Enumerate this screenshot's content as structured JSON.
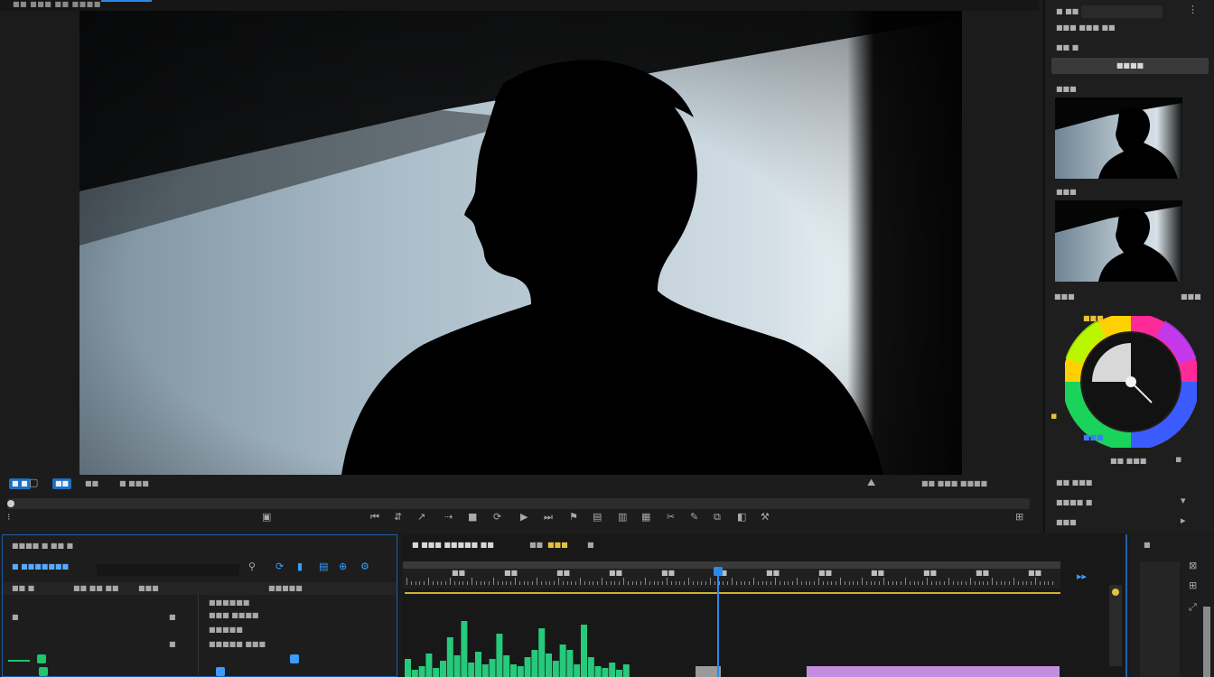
{
  "app": {
    "menu_text": "■■ ■■■ ■■ ■■■■",
    "accent": "#2b8ae8"
  },
  "viewer": {
    "control_tags": [
      "■ ■",
      "■■"
    ],
    "control_text_a": "■■",
    "control_text_b": "■ ■■■",
    "control_text_right": "■■ ■■■ ■■■■"
  },
  "inspector": {
    "header": "■ ■■ ■",
    "subheader": "■■■ ■■■ ■■",
    "section1": "■■ ■",
    "apply_button": "■■■■",
    "section2": "■■■",
    "section3": "■■■",
    "color_title": "■■■",
    "color_right": "■■■",
    "wheel_label_top": "■■■",
    "wheel_label_bottom": "■■■",
    "opt1": "■■ ■■■",
    "opt2": "■■ ■■■",
    "opt3": "■■■■ ■",
    "opt4": "■■■",
    "wheel_colors": [
      "#ff0000",
      "#ffff00",
      "#00ff00",
      "#00ffff",
      "#0000ff",
      "#ff00ff",
      "#ff0000"
    ]
  },
  "project_panel": {
    "title": "■■■■ ■ ■■ ■",
    "path": "■ ■■■■■■■",
    "col_a": "■■ ■",
    "col_b": "■■ ■■ ■■",
    "col_c": "■■■",
    "col_d": "■■■■■",
    "items": [
      "■■■■■■",
      "■■■ ■■■■",
      "■■■■■",
      "■■■■■ ■■■"
    ],
    "row_icons": [
      "■",
      "■",
      "■"
    ]
  },
  "timeline": {
    "title": "■ ■■■ ■■■■■ ■■",
    "tab2": "■■",
    "tab3": "■■■",
    "tab4": "■",
    "ticks": [
      "■■",
      "■■",
      "■■",
      "■■",
      "■■",
      "■■",
      "■■",
      "■■",
      "■■",
      "■■",
      "■■",
      "■■"
    ],
    "waveform": [
      20,
      8,
      12,
      26,
      10,
      18,
      44,
      24,
      62,
      16,
      28,
      14,
      20,
      48,
      24,
      14,
      12,
      22,
      30,
      54,
      26,
      18,
      36,
      30,
      14,
      58,
      22,
      12,
      10,
      16,
      8,
      14
    ]
  },
  "mini_panel": {
    "title": "■"
  }
}
